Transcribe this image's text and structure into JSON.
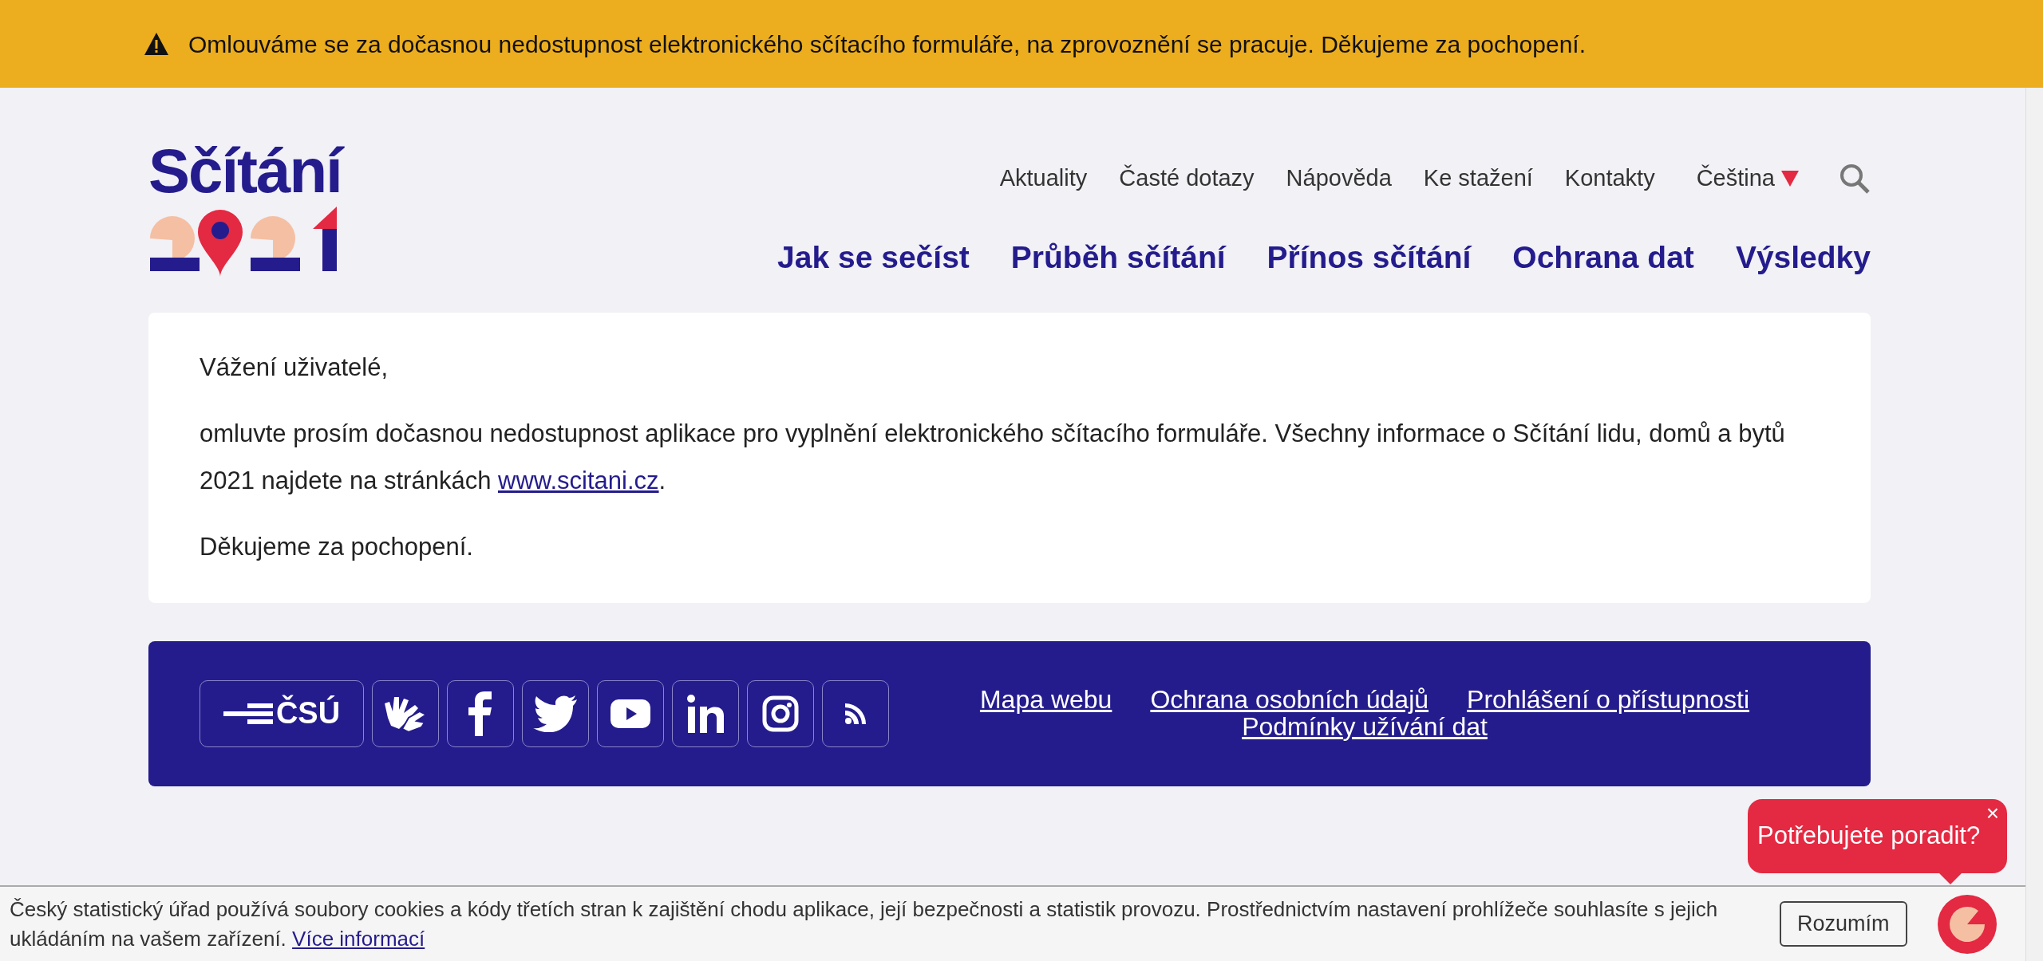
{
  "alert_banner": {
    "text": "Omlouváme se za dočasnou nedostupnost elektronického sčítacího formuláře, na zprovoznění se pracuje. Děkujeme za pochopení."
  },
  "header": {
    "logo_text": "Sčítání",
    "top_nav": [
      {
        "label": "Aktuality"
      },
      {
        "label": "Časté dotazy"
      },
      {
        "label": "Nápověda"
      },
      {
        "label": "Ke stažení"
      },
      {
        "label": "Kontakty"
      }
    ],
    "language": {
      "label": "Čeština",
      "expanded": false
    },
    "main_nav": [
      {
        "label": "Jak se sečíst"
      },
      {
        "label": "Průběh sčítání"
      },
      {
        "label": "Přínos sčítání"
      },
      {
        "label": "Ochrana dat"
      },
      {
        "label": "Výsledky"
      }
    ]
  },
  "message": {
    "greeting": "Vážení uživatelé,",
    "body": "omluvte prosím dočasnou nedostupnost aplikace pro vyplnění elektronického sčítacího formuláře. Všechny informace o Sčítání lidu, domů a bytů 2021 najdete na stránkách ",
    "link": "www.scitani.cz",
    "body_end": ".",
    "closing": "Děkujeme za pochopení."
  },
  "footer": {
    "social": [
      {
        "kind": "csu",
        "label": "ČSÚ"
      },
      {
        "kind": "sign"
      },
      {
        "kind": "facebook"
      },
      {
        "kind": "twitter"
      },
      {
        "kind": "youtube"
      },
      {
        "kind": "linkedin"
      },
      {
        "kind": "instagram"
      },
      {
        "kind": "rss"
      }
    ],
    "links": [
      {
        "label": "Mapa webu"
      },
      {
        "label": "Ochrana osobních údajů"
      },
      {
        "label": "Prohlášení o přístupnosti"
      },
      {
        "label": "Podmínky užívání dat"
      }
    ]
  },
  "cookie_bar": {
    "text": "Český statistický úřad používá soubory cookies a kódy třetích stran k zajištění chodu aplikace, její bezpečnosti a statistik provozu. Prostřednictvím nastavení prohlížeče souhlasíte s jejich ukládáním na vašem zařízení. ",
    "link": "Více informací",
    "button": "Rozumím"
  },
  "chat": {
    "bubble": "Potřebujete poradit?",
    "close": "×"
  }
}
